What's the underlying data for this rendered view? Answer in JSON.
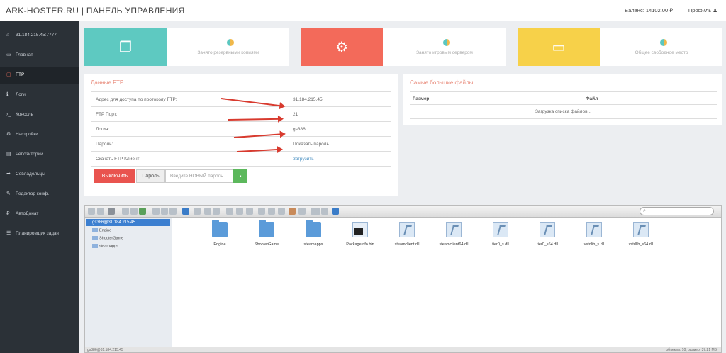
{
  "header": {
    "brand": "ARK-HOSTER.RU | ПАНЕЛЬ УПРАВЛЕНИЯ",
    "balance": "Баланс: 14102.00 ₽",
    "profile": "Профиль ♟"
  },
  "sidebar": {
    "items": [
      {
        "icon": "home-icon",
        "glyph": "⌂",
        "label": "31.184.215.45:7777"
      },
      {
        "icon": "monitor-icon",
        "glyph": "▭",
        "label": "Главная"
      },
      {
        "icon": "folder-icon",
        "glyph": "▢",
        "label": "FTP"
      },
      {
        "icon": "info-icon",
        "glyph": "ℹ",
        "label": "Логи"
      },
      {
        "icon": "terminal-icon",
        "glyph": "›_",
        "label": "Консоль"
      },
      {
        "icon": "gears-icon",
        "glyph": "⚙",
        "label": "Настройки"
      },
      {
        "icon": "archive-icon",
        "glyph": "▤",
        "label": "Репозиторий"
      },
      {
        "icon": "share-icon",
        "glyph": "➦",
        "label": "Совладельцы"
      },
      {
        "icon": "edit-icon",
        "glyph": "✎",
        "label": "Редактор конф."
      },
      {
        "icon": "ruble-icon",
        "glyph": "₽",
        "label": "АвтоДонат"
      },
      {
        "icon": "list-icon",
        "glyph": "☰",
        "label": "Планировщик задач"
      }
    ]
  },
  "stats": [
    {
      "icon": "copy-icon",
      "glyph": "❐",
      "color": "#5ec9c1",
      "label": "Занято резервными копиями"
    },
    {
      "icon": "gear-icon",
      "glyph": "⚙",
      "color": "#f36a5a",
      "label": "Занято игровым сервером"
    },
    {
      "icon": "hdd-icon",
      "glyph": "▭",
      "color": "#f7d149",
      "label": "Общее свободное место"
    }
  ],
  "ftp": {
    "title": "Данные FTP",
    "rows": [
      {
        "key": "Адрес для доступа по протоколу FTP:",
        "value": "31.184.215.45"
      },
      {
        "key": "FTP Порт:",
        "value": "21"
      },
      {
        "key": "Логин:",
        "value": "gs386"
      },
      {
        "key": "Пароль:",
        "value": "Показать пароль"
      },
      {
        "key": "Скачать FTP Клиент:",
        "value": "Загрузить"
      }
    ],
    "disable_button": "Выключить",
    "password_button": "Пароль",
    "password_placeholder": "Введите НОВЫЙ пароль"
  },
  "largest_files": {
    "title": "Самые большие файлы",
    "col_size": "Размер",
    "col_file": "Файл",
    "loading": "Загрузка списка файлов..."
  },
  "file_manager": {
    "search_icon": "⌕",
    "tree_root": "gs386@31.184.215.45",
    "tree": [
      "Engine",
      "ShooterGame",
      "steamapps"
    ],
    "files": [
      {
        "name": "Engine",
        "type": "folder"
      },
      {
        "name": "ShooterGame",
        "type": "folder"
      },
      {
        "name": "steamapps",
        "type": "folder"
      },
      {
        "name": "PackageInfo.bin",
        "type": "bin"
      },
      {
        "name": "steamclient.dll",
        "type": "dll"
      },
      {
        "name": "steamclient64.dll",
        "type": "dll"
      },
      {
        "name": "tier0_s.dll",
        "type": "dll"
      },
      {
        "name": "tier0_s64.dll",
        "type": "dll"
      },
      {
        "name": "vstdlib_s.dll",
        "type": "dll"
      },
      {
        "name": "vstdlib_s64.dll",
        "type": "dll"
      }
    ],
    "status_left": "gs386@31.184.215.45",
    "status_right": "объекты: 10, размер: 37.21 MB"
  }
}
